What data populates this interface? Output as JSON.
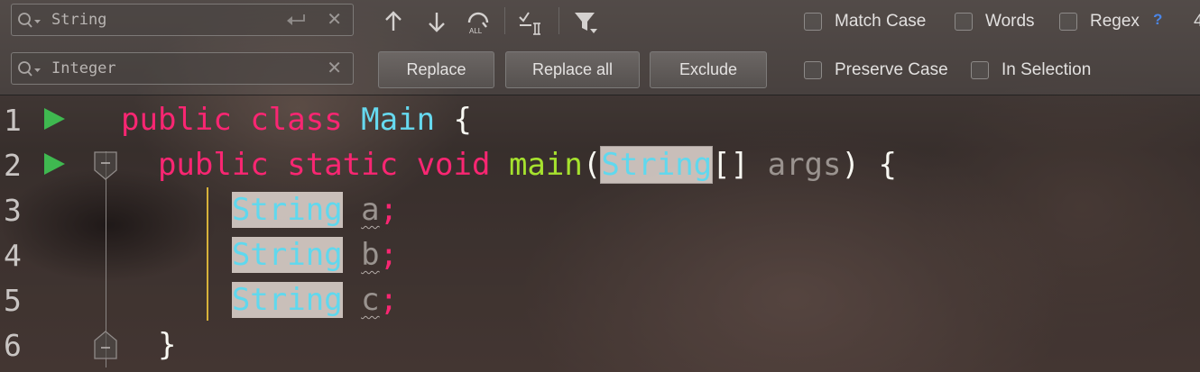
{
  "search": {
    "find_value": "String",
    "replace_value": "Integer"
  },
  "toolbar": {
    "icons": [
      "arrow-up-icon",
      "arrow-down-icon",
      "select-all-occurrences-icon",
      "filter-search-results-icon",
      "filter-icon"
    ],
    "replace_label": "Replace",
    "replace_all_label": "Replace all",
    "exclude_label": "Exclude"
  },
  "options": {
    "match_case": {
      "label": "Match Case",
      "checked": false
    },
    "words": {
      "label": "Words",
      "checked": false
    },
    "regex": {
      "label": "Regex",
      "checked": false
    },
    "regex_help": "?",
    "preserve_case": {
      "label": "Preserve Case",
      "checked": false
    },
    "in_selection": {
      "label": "In Selection",
      "checked": false
    },
    "truncated_text": "4"
  },
  "editor": {
    "line_numbers": [
      "1",
      "2",
      "3",
      "4",
      "5",
      "6"
    ],
    "lines": {
      "l1": {
        "kw1": "public",
        "kw2": "class",
        "name": "Main",
        "brace": "{"
      },
      "l2": {
        "kw1": "public",
        "kw2": "static",
        "kw3": "void",
        "fn": "main",
        "paren_open": "(",
        "type": "String",
        "brackets": "[]",
        "param": "args",
        "paren_close": ")",
        "brace": "{"
      },
      "l3": {
        "type": "String",
        "var": "a",
        "semi": ";"
      },
      "l4": {
        "type": "String",
        "var": "b",
        "semi": ";"
      },
      "l5": {
        "type": "String",
        "var": "c",
        "semi": ";"
      },
      "l6": {
        "brace": "}"
      }
    }
  },
  "colors": {
    "keyword": "#f92672",
    "type": "#66d9ef",
    "function": "#a6e22e",
    "match_highlight": "#e8ded8",
    "help_link": "#4a86e8",
    "indent_guide": "#d7b23a"
  }
}
